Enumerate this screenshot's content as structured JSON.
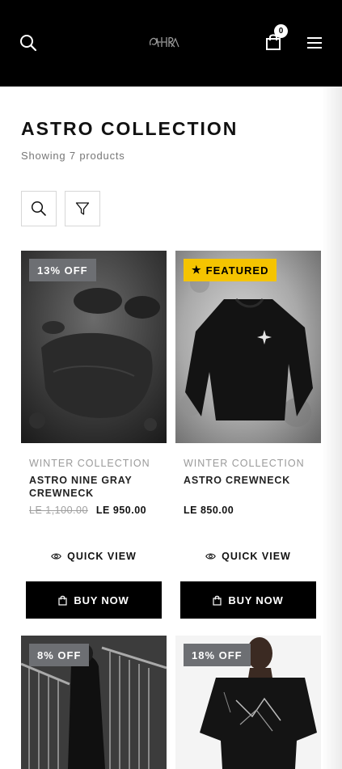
{
  "header": {
    "logo_text": "ASTRA",
    "cart_count": "0",
    "icons": [
      "search-icon",
      "logo",
      "shopping-bag-icon",
      "menu-icon"
    ]
  },
  "page": {
    "title": "ASTRO COLLECTION",
    "subtitle": "Showing 7 products"
  },
  "toolbar": {
    "icons": [
      "search-icon",
      "filter-icon"
    ]
  },
  "actions": {
    "quick_view": "QUICK VIEW",
    "buy_now": "BUY NOW"
  },
  "products": [
    {
      "badge": "13% OFF",
      "collection": "WINTER COLLECTION",
      "name": "ASTRO NINE GRAY CREWNECK",
      "old_price": "LE 1,100.00",
      "price": "LE 950.00"
    },
    {
      "badge": "FEATURED",
      "collection": "WINTER COLLECTION",
      "name": "ASTRO CREWNECK",
      "old_price": "",
      "price": "LE 850.00"
    },
    {
      "badge": "8% OFF"
    },
    {
      "badge": "18% OFF"
    }
  ],
  "colors": {
    "header_bg": "#000000",
    "featured_badge": "#f5c400",
    "discount_badge": "#6d6f73",
    "buy_button": "#000000"
  }
}
